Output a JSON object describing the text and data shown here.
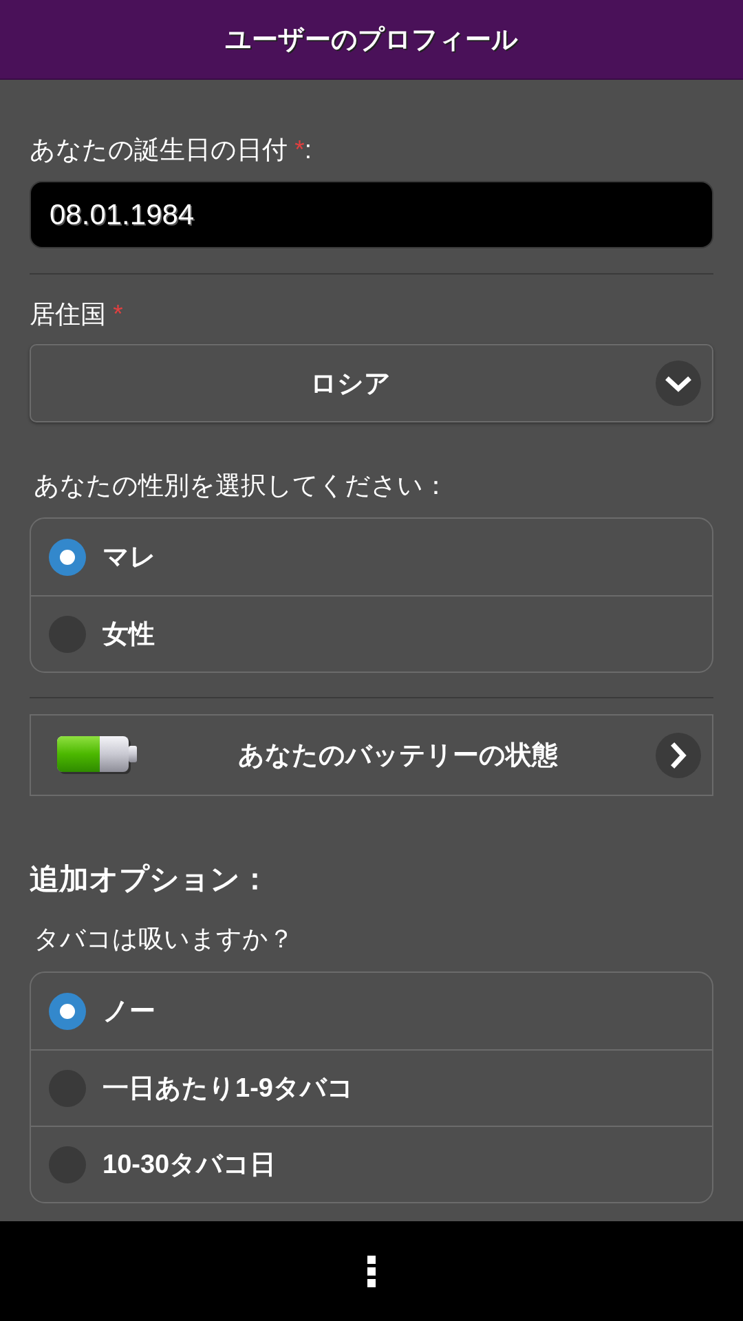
{
  "title_bar": {
    "title": "ユーザーのプロフィール"
  },
  "birth_date": {
    "label": "あなたの誕生日の日付",
    "required_mark": "*",
    "suffix": ":",
    "value": "08.01.1984"
  },
  "country": {
    "label": "居住国",
    "required_mark": "*",
    "value": "ロシア"
  },
  "gender": {
    "label": "あなたの性別を選択してください：",
    "options": [
      {
        "label": "マレ",
        "selected": true
      },
      {
        "label": "女性",
        "selected": false
      }
    ]
  },
  "battery_button": {
    "label": "あなたのバッテリーの状態"
  },
  "additional_options": {
    "heading": "追加オプション：",
    "smoking": {
      "question": "タバコは吸いますか？",
      "options": [
        {
          "label": "ノー",
          "selected": true
        },
        {
          "label": "一日あたり1-9タバコ",
          "selected": false
        },
        {
          "label": "10-30タバコ日",
          "selected": false
        }
      ]
    }
  }
}
